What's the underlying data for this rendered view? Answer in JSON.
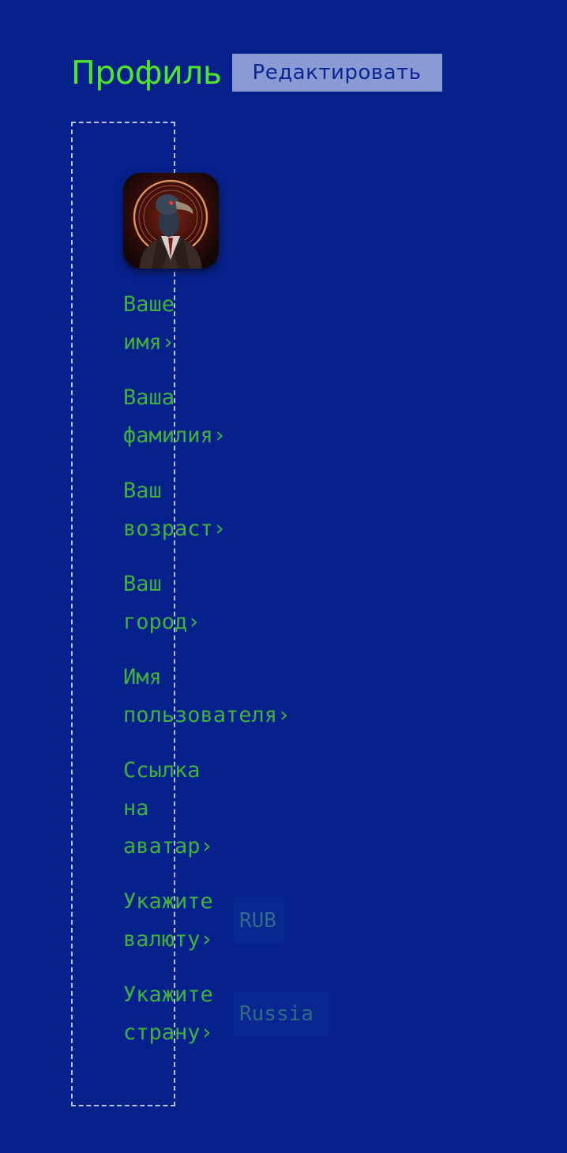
{
  "header": {
    "title": "Профиль",
    "edit_button": "Редактировать"
  },
  "profile": {
    "avatar_icon": "avatar-image",
    "fields": [
      {
        "line1": "Ваше",
        "line2": "имя›"
      },
      {
        "line1": "Ваша",
        "line2": "фамилия›"
      },
      {
        "line1": "Ваш",
        "line2": "возраст›"
      },
      {
        "line1": "Ваш",
        "line2": "город›"
      },
      {
        "line1": "Имя",
        "line2": "пользователя›"
      },
      {
        "line1": "Ссылка",
        "line2": "на",
        "line3": "аватар›"
      },
      {
        "line1": "Укажите",
        "line2": "валюту›",
        "value": "RUB"
      },
      {
        "line1": "Укажите",
        "line2": "страну›",
        "value": "Russia"
      }
    ]
  },
  "colors": {
    "background": "#07218c",
    "title": "#4ee62a",
    "label": "#3fb13c",
    "button_bg": "#8a9ad4",
    "button_text": "#0a2590",
    "value_text": "#2f6c8a"
  }
}
